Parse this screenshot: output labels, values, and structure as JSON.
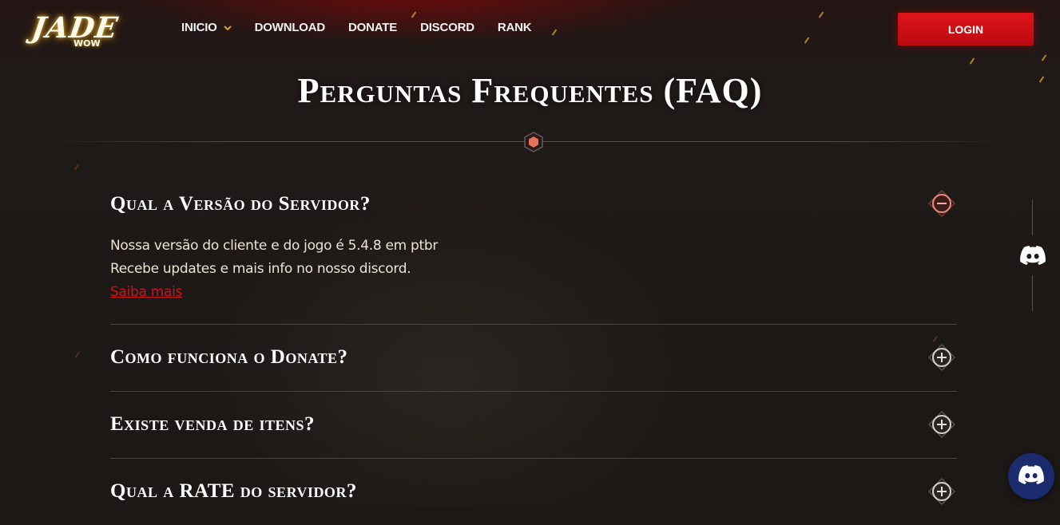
{
  "brand": {
    "logo_text": "JADE",
    "logo_sub": "WOW"
  },
  "nav": {
    "items": [
      {
        "label": "INICIO",
        "has_dropdown": true
      },
      {
        "label": "DOWNLOAD"
      },
      {
        "label": "DONATE"
      },
      {
        "label": "DISCORD"
      },
      {
        "label": "RANK"
      }
    ],
    "login_label": "LOGIN"
  },
  "page": {
    "title": "Perguntas Frequentes (FAQ)"
  },
  "faq": {
    "items": [
      {
        "question": "Qual a Versão do Servidor?",
        "expanded": true,
        "answer_lines": [
          "Nossa versão do cliente e do jogo é 5.4.8 em ptbr",
          "Recebe updates e mais info no nosso discord."
        ],
        "link_label": "Saiba mais"
      },
      {
        "question": "Como funciona o Donate?",
        "expanded": false
      },
      {
        "question": "Existe venda de itens?",
        "expanded": false
      },
      {
        "question": "Qual a RATE do servidor?",
        "expanded": false
      }
    ]
  },
  "colors": {
    "accent_red": "#d4121a",
    "link_red": "#c8141a",
    "gold": "#d6a23a",
    "discord_blue": "#1c2a6e"
  },
  "icons": {
    "toggle_expanded": "minus-circle-icon",
    "toggle_collapsed": "plus-circle-icon",
    "side": "discord-icon",
    "fab": "discord-icon"
  }
}
